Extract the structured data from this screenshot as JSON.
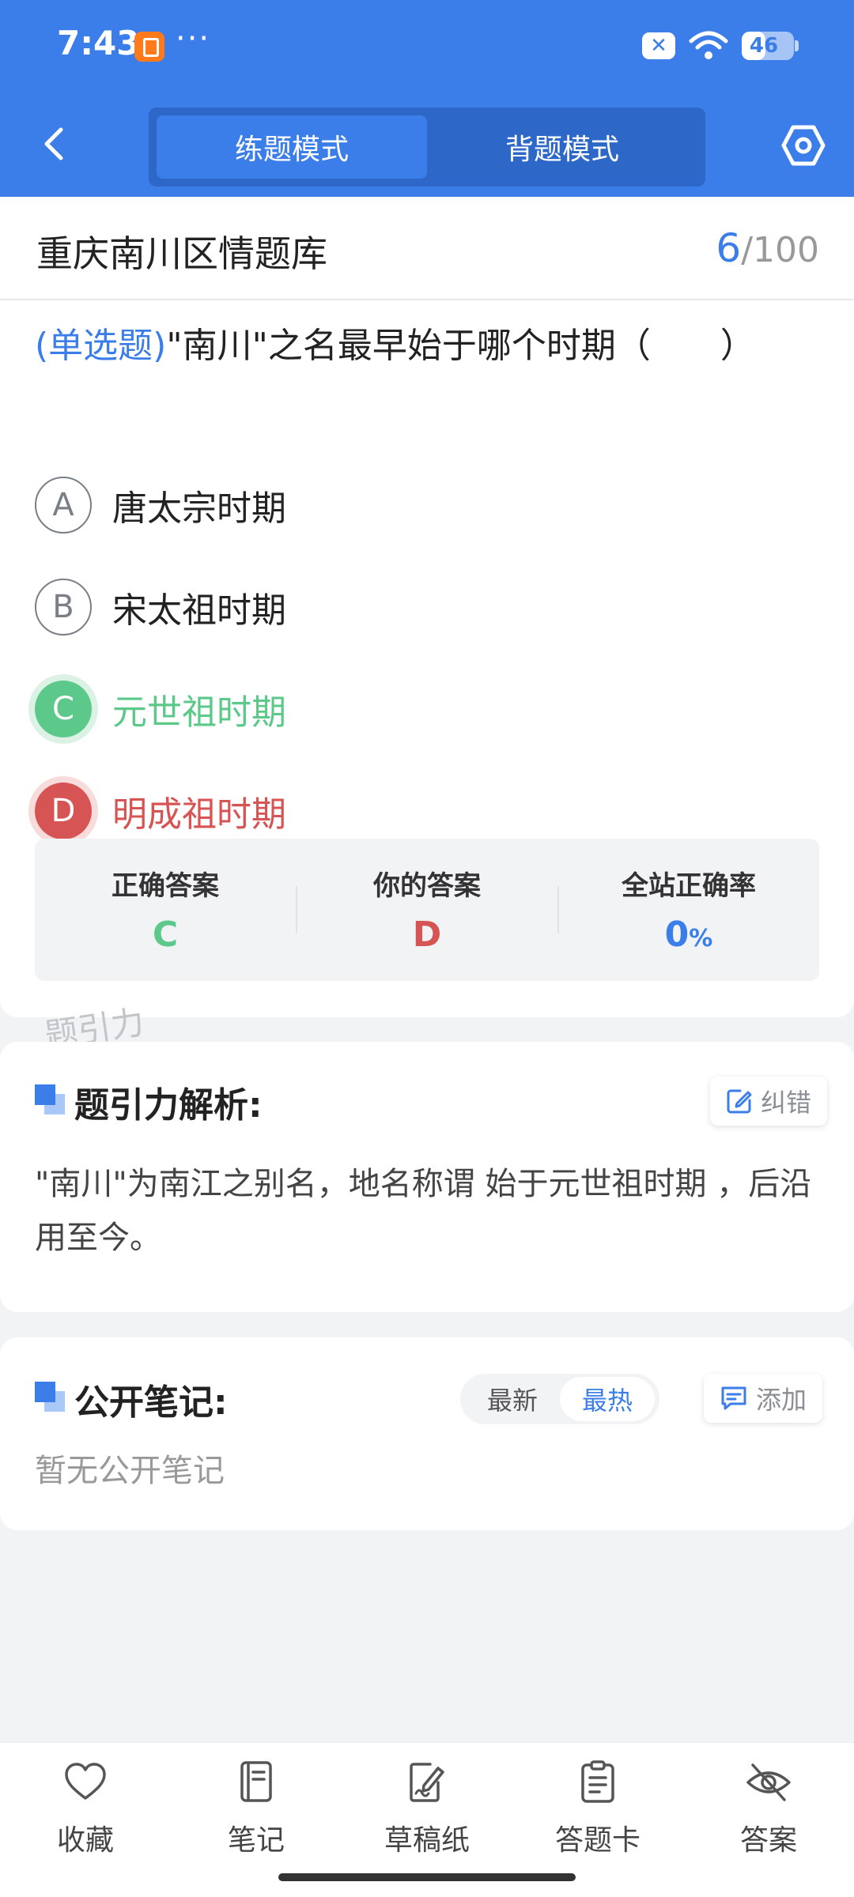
{
  "status_bar": {
    "time": "7:43",
    "more": "···",
    "battery": "46",
    "battery_level": 0.46
  },
  "nav": {
    "tabs": [
      {
        "label": "练题模式",
        "active": true
      },
      {
        "label": "背题模式",
        "active": false
      }
    ]
  },
  "quiz": {
    "bank_title": "重庆南川区情题库",
    "current": "6",
    "separator": "/",
    "total": "100",
    "question_type": "(单选题)",
    "question_text": "\"南川\"之名最早始于哪个时期（　　）",
    "options": [
      {
        "letter": "A",
        "text": "唐太宗时期",
        "state": "normal"
      },
      {
        "letter": "B",
        "text": "宋太祖时期",
        "state": "normal"
      },
      {
        "letter": "C",
        "text": "元世祖时期",
        "state": "correct"
      },
      {
        "letter": "D",
        "text": "明成祖时期",
        "state": "wrong"
      }
    ],
    "result": {
      "correct_label": "正确答案",
      "correct_value": "C",
      "yours_label": "你的答案",
      "yours_value": "D",
      "rate_label": "全站正确率",
      "rate_value": "0",
      "rate_unit": "%"
    }
  },
  "watermark": "题引力",
  "analysis": {
    "title": "题引力解析:",
    "report_label": "纠错",
    "text": "\"南川\"为南江之别名，地名称谓 始于元世祖时期 ，后沿用至今。"
  },
  "notes": {
    "title": "公开笔记:",
    "sort_latest": "最新",
    "sort_hot": "最热",
    "add_label": "添加",
    "empty": "暂无公开笔记"
  },
  "bottom_bar": {
    "items": [
      {
        "label": "收藏",
        "icon": "heart-icon"
      },
      {
        "label": "笔记",
        "icon": "notebook-icon"
      },
      {
        "label": "草稿纸",
        "icon": "draft-icon"
      },
      {
        "label": "答题卡",
        "icon": "answer-card-icon"
      },
      {
        "label": "答案",
        "icon": "eye-off-icon"
      }
    ]
  },
  "colors": {
    "primary": "#3b7de9",
    "correct": "#5cc98a",
    "wrong": "#d65454",
    "background": "#f2f3f5"
  }
}
